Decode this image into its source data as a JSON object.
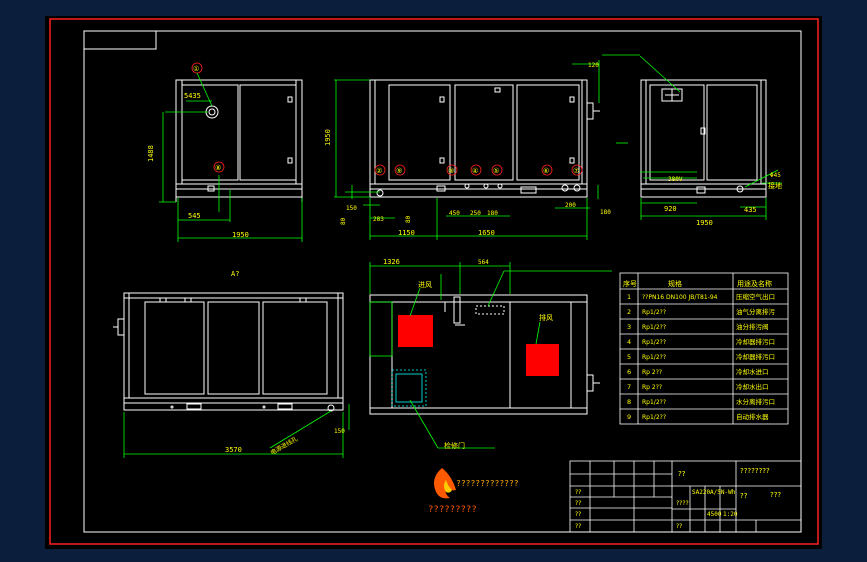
{
  "colors": {
    "background": "#0b1e3c",
    "paper": "#000000",
    "frame": "#ff2020",
    "line": "#ffffff",
    "dim": "#00ff00",
    "hatch": "#ff0000",
    "note": "#ff40ff",
    "text": "#ffff00"
  },
  "drawing": {
    "view_label": "A?",
    "front": {
      "dims": {
        "d1": "5435",
        "d2": "1488",
        "d3": "545",
        "d4": "1950"
      },
      "callouts": {
        "c1": "①",
        "c2": "⑧"
      }
    },
    "side": {
      "dims": {
        "h": "1950",
        "a": "150",
        "b": "80",
        "c": "283",
        "d": "80",
        "e": "1150",
        "f": "450",
        "g": "250",
        "i": "180",
        "j": "1650",
        "k": "200",
        "l": "180"
      },
      "callouts": [
        "②",
        "⑨",
        "③",
        "④",
        "⑤",
        "⑥",
        "⑦"
      ]
    },
    "right": {
      "dims": {
        "top": "120",
        "w": "920",
        "w2": "1950",
        "r": "435",
        "dia": "Φ45"
      },
      "notes": {
        "label1": "380V",
        "label2": "接地"
      }
    },
    "plan": {
      "dims": {
        "a": "1326",
        "b": "564",
        "c": "3570",
        "d": "150"
      },
      "notes": {
        "n1": "进风",
        "n2": "排风",
        "n3": "检修门",
        "n4": "电源进线孔"
      }
    }
  },
  "parts_table": {
    "header": {
      "no": "序号",
      "spec": "规格",
      "name": "用途及名称"
    },
    "rows": [
      {
        "no": "1",
        "spec": "??PN16 DN100  JB/T81-94",
        "name": "压缩空气出口"
      },
      {
        "no": "2",
        "spec": "Rp1/2??",
        "name": "油气分离排污"
      },
      {
        "no": "3",
        "spec": "Rp1/2??",
        "name": "油分排污阀"
      },
      {
        "no": "4",
        "spec": "Rp1/2??",
        "name": "冷却器排污口"
      },
      {
        "no": "5",
        "spec": "Rp1/2??",
        "name": "冷却器排污口"
      },
      {
        "no": "6",
        "spec": "Rp 2??",
        "name": "冷却水进口"
      },
      {
        "no": "7",
        "spec": "Rp 2??",
        "name": "冷却水出口"
      },
      {
        "no": "8",
        "spec": "Rp1/2??",
        "name": "水分离排污口"
      },
      {
        "no": "9",
        "spec": "Rp1/2??",
        "name": "自动排水器"
      }
    ]
  },
  "title_block": {
    "title_a": "??",
    "title_b": "????????",
    "model": "SA220A/5N-Wh",
    "weight": "4500",
    "scale": "1:20",
    "sheet": "??",
    "name2": "???",
    "cells": [
      "??",
      "??",
      "????",
      "??",
      "??",
      "??"
    ]
  },
  "logo": {
    "company_line": "?????????????",
    "company_sub": "?????????"
  }
}
